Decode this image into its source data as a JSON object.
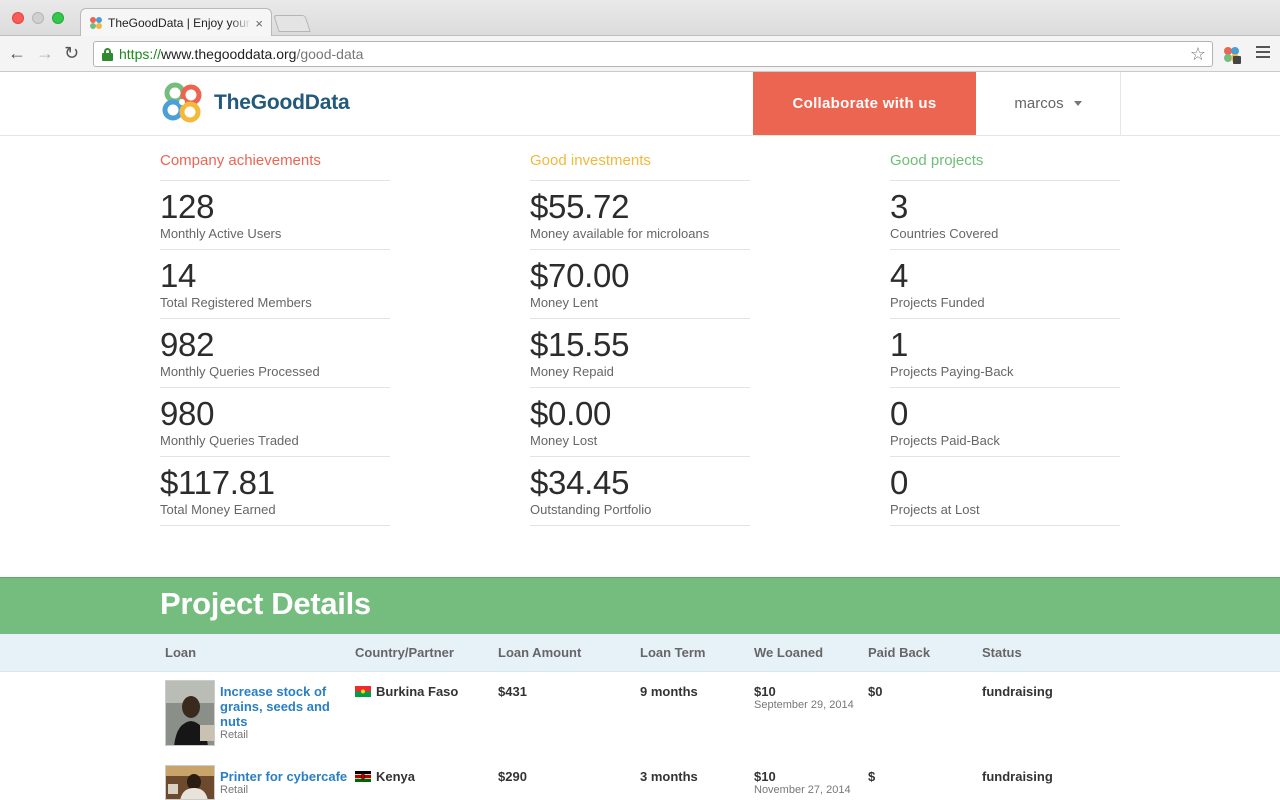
{
  "browser": {
    "tab_title": "TheGoodData | Enjoy your data",
    "tab_close": "×",
    "url_scheme": "https://",
    "url_host": "www.thegooddata.org",
    "url_path": "/good-data",
    "star": "☆"
  },
  "header": {
    "logo_text": "TheGoodData",
    "collaborate_label": "Collaborate with us",
    "user_name": "marcos"
  },
  "stats": {
    "company": {
      "heading": "Company achievements",
      "items": [
        {
          "value": "128",
          "label": "Monthly Active Users"
        },
        {
          "value": "14",
          "label": "Total Registered Members"
        },
        {
          "value": "982",
          "label": "Monthly Queries Processed"
        },
        {
          "value": "980",
          "label": "Monthly Queries Traded"
        },
        {
          "value": "$117.81",
          "label": "Total Money Earned"
        }
      ]
    },
    "investments": {
      "heading": "Good investments",
      "items": [
        {
          "value": "$55.72",
          "label": "Money available for microloans"
        },
        {
          "value": "$70.00",
          "label": "Money Lent"
        },
        {
          "value": "$15.55",
          "label": "Money Repaid"
        },
        {
          "value": "$0.00",
          "label": "Money Lost"
        },
        {
          "value": "$34.45",
          "label": "Outstanding Portfolio"
        }
      ]
    },
    "projects": {
      "heading": "Good projects",
      "items": [
        {
          "value": "3",
          "label": "Countries Covered"
        },
        {
          "value": "4",
          "label": "Projects Funded"
        },
        {
          "value": "1",
          "label": "Projects Paying-Back"
        },
        {
          "value": "0",
          "label": "Projects Paid-Back"
        },
        {
          "value": "0",
          "label": "Projects at Lost"
        }
      ]
    }
  },
  "details": {
    "title": "Project Details",
    "columns": {
      "loan": "Loan",
      "country": "Country/Partner",
      "amount": "Loan Amount",
      "term": "Loan Term",
      "loaned": "We Loaned",
      "paid": "Paid Back",
      "status": "Status"
    },
    "rows": [
      {
        "title": "Increase stock of grains, seeds and nuts",
        "sector": "Retail",
        "country": "Burkina Faso",
        "amount": "$431",
        "term": "9 months",
        "loaned": "$10",
        "loaned_date": "September 29, 2014",
        "paid": "$0",
        "status": "fundraising"
      },
      {
        "title": "Printer for cybercafe",
        "sector": "Retail",
        "country": "Kenya",
        "amount": "$290",
        "term": "3 months",
        "loaned": "$10",
        "loaned_date": "November 27, 2014",
        "paid": "$",
        "status": "fundraising"
      }
    ]
  }
}
